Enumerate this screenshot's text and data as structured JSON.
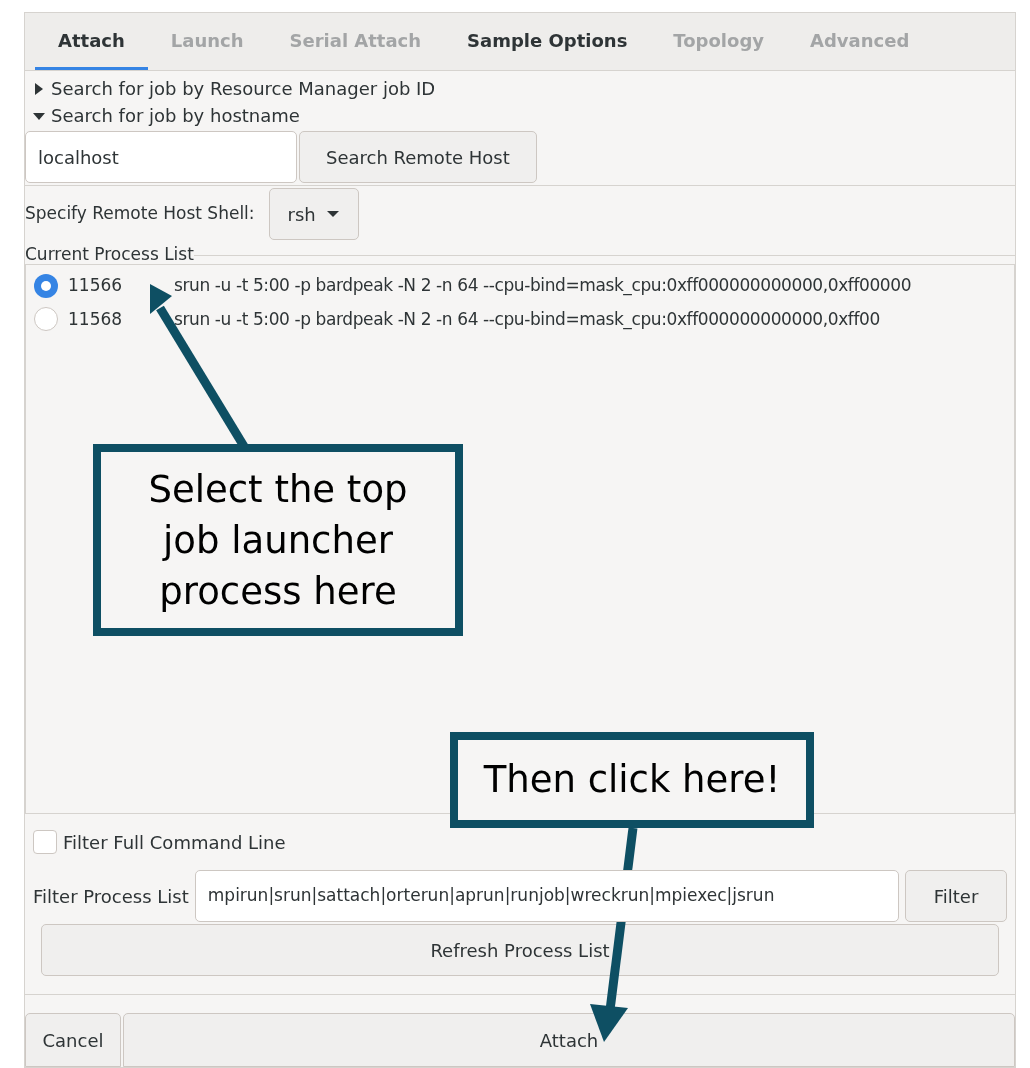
{
  "tabs": [
    {
      "label": "Attach",
      "selected": true,
      "disabled": false
    },
    {
      "label": "Launch",
      "selected": false,
      "disabled": true
    },
    {
      "label": "Serial Attach",
      "selected": false,
      "disabled": true
    },
    {
      "label": "Sample Options",
      "selected": false,
      "disabled": false
    },
    {
      "label": "Topology",
      "selected": false,
      "disabled": true
    },
    {
      "label": "Advanced",
      "selected": false,
      "disabled": true
    }
  ],
  "sections": [
    {
      "label": "Search for job by Resource Manager job ID",
      "expanded": false
    },
    {
      "label": "Search for job by hostname",
      "expanded": true
    }
  ],
  "hostname_field": {
    "value": "localhost"
  },
  "search_button": "Search Remote Host",
  "shell": {
    "label": "Specify Remote Host Shell:",
    "value": "rsh"
  },
  "process_list": {
    "title": "Current Process List",
    "rows": [
      {
        "pid": "11566",
        "command": "srun -u -t 5:00 -p bardpeak -N 2 -n 64 --cpu-bind=mask_cpu:0xff000000000000,0xff00000",
        "selected": true
      },
      {
        "pid": "11568",
        "command": "srun -u -t 5:00 -p bardpeak -N 2 -n 64 --cpu-bind=mask_cpu:0xff000000000000,0xff00",
        "selected": false
      }
    ]
  },
  "filter_full_command_line": {
    "label": "Filter Full Command Line",
    "checked": false
  },
  "filter": {
    "label": "Filter Process List",
    "value": "mpirun|srun|sattach|orterun|aprun|runjob|wreckrun|mpiexec|jsrun",
    "button": "Filter"
  },
  "refresh_button": "Refresh Process List",
  "buttons": [
    "Cancel",
    "Attach"
  ],
  "annotations": [
    {
      "text": "Select the top job launcher process here"
    },
    {
      "text": "Then click here!"
    }
  ]
}
